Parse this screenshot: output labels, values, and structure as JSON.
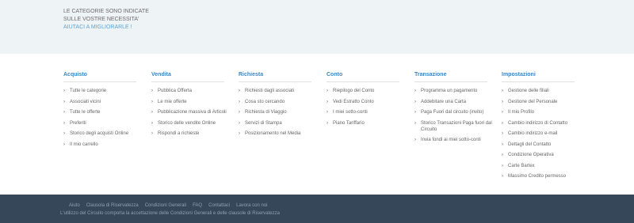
{
  "notice": {
    "text": "LE CATEGORIE SONO INDICATE SULLE VOSTRE NECESSITA'",
    "link": "AIUTACI A MIGLIORARLE !"
  },
  "menu": [
    {
      "title": "Acquisto",
      "items": [
        "Tutte le categorie",
        "Associati vicini",
        "Tutte le offerte",
        "Preferiti",
        "Storico degli acquisti Online",
        "Il mio carrello"
      ]
    },
    {
      "title": "Vendita",
      "items": [
        "Pubblica Offerta",
        "Le mie offerte",
        "Pubblicazione massiva di Articoli",
        "Storico delle vendite Online",
        "Rispondi a richieste"
      ]
    },
    {
      "title": "Richiesta",
      "items": [
        "Richiesti dagli associati",
        "Cosa sto cercando",
        "Richiesta di Viaggio",
        "Servizi di Stampa",
        "Posizionamento nel Media"
      ]
    },
    {
      "title": "Conto",
      "items": [
        "Riepilogo del Conto",
        "Vedi Estratto Conto",
        "I miei sotto-conti",
        "Piano Tariffario"
      ]
    },
    {
      "title": "Transazione",
      "items": [
        "Programma un pagamento",
        "Addebitare una Carta",
        "Paga Fuori dal circuito (invito)",
        "Storico Transazioni Paga fuori dal Circuito",
        "Invia fondi ai miei sotto-conti"
      ]
    },
    {
      "title": "Impostazioni",
      "items": [
        "Gestione delle filiali",
        "Gestione del Personale",
        "Il mio Profilo",
        "Cambio indirizzo di Contatto",
        "Cambio indirizzo e-mail",
        "Dettagli del Contatto",
        "Condizione Operativa",
        "Carte Bartex",
        "Massimo Credito permesso"
      ]
    }
  ],
  "footer": {
    "links": [
      "Aiuto",
      "Clausola di Riservatezza",
      "Condizioni Generali",
      "FAQ",
      "Contattaci",
      "Lavora con noi"
    ],
    "line": "L'utilizzo del Circuito comporta la accettazione delle Condizioni Generali e delle clausole di Riservatezza"
  },
  "colors": {
    "accent": "#3b86c4",
    "link": "#5aa6d8",
    "top_band": "#eef3f6",
    "footer_bg": "#37475a"
  },
  "icons": {
    "bullet": "chevron-right-icon"
  }
}
